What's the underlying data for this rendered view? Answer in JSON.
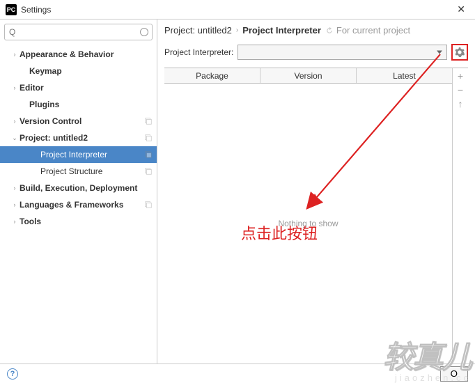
{
  "window": {
    "title": "Settings",
    "icon_text": "PC"
  },
  "search": {
    "placeholder": "Q"
  },
  "tree": [
    {
      "label": "Appearance & Behavior",
      "arrow": "›",
      "indent": 1,
      "bold": true,
      "copy": false
    },
    {
      "label": "Keymap",
      "arrow": "",
      "indent": 2,
      "bold": true,
      "copy": false
    },
    {
      "label": "Editor",
      "arrow": "›",
      "indent": 1,
      "bold": true,
      "copy": false
    },
    {
      "label": "Plugins",
      "arrow": "",
      "indent": 2,
      "bold": true,
      "copy": false
    },
    {
      "label": "Version Control",
      "arrow": "›",
      "indent": 1,
      "bold": true,
      "copy": true
    },
    {
      "label": "Project: untitled2",
      "arrow": "⌄",
      "indent": 1,
      "bold": true,
      "copy": true
    },
    {
      "label": "Project Interpreter",
      "arrow": "",
      "indent": 3,
      "bold": false,
      "copy": true,
      "selected": true
    },
    {
      "label": "Project Structure",
      "arrow": "",
      "indent": 3,
      "bold": false,
      "copy": true
    },
    {
      "label": "Build, Execution, Deployment",
      "arrow": "›",
      "indent": 1,
      "bold": true,
      "copy": false
    },
    {
      "label": "Languages & Frameworks",
      "arrow": "›",
      "indent": 1,
      "bold": true,
      "copy": true
    },
    {
      "label": "Tools",
      "arrow": "›",
      "indent": 1,
      "bold": true,
      "copy": false
    }
  ],
  "breadcrumb": {
    "project": "Project: untitled2",
    "page": "Project Interpreter",
    "for": "For current project"
  },
  "interpreter": {
    "label": "Project Interpreter:",
    "value": ""
  },
  "table": {
    "headers": [
      "Package",
      "Version",
      "Latest"
    ],
    "empty": "Nothing to show"
  },
  "side_buttons": [
    "+",
    "−",
    "↑"
  ],
  "footer": {
    "ok": "O"
  },
  "annotation": {
    "text": "点击此按钮"
  },
  "watermark": {
    "big": "较真儿",
    "small": "jiaozhen.cc"
  }
}
